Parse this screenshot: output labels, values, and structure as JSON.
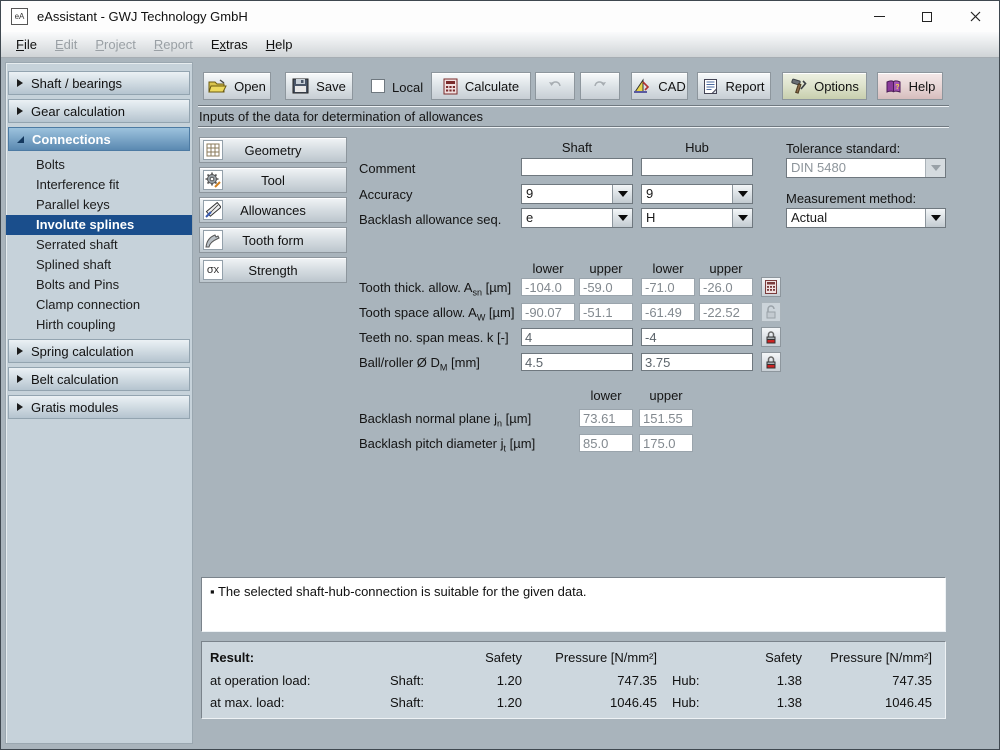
{
  "window": {
    "title": "eAssistant - GWJ Technology GmbH",
    "icon_text": "eA"
  },
  "menu": {
    "items": [
      {
        "pre": "",
        "key": "F",
        "post": "ile",
        "enabled": true
      },
      {
        "pre": "",
        "key": "E",
        "post": "dit",
        "enabled": false
      },
      {
        "pre": "",
        "key": "P",
        "post": "roject",
        "enabled": false
      },
      {
        "pre": "",
        "key": "R",
        "post": "eport",
        "enabled": false
      },
      {
        "pre": "E",
        "key": "x",
        "post": "tras",
        "enabled": true
      },
      {
        "pre": "",
        "key": "H",
        "post": "elp",
        "enabled": true
      }
    ]
  },
  "sidebar": {
    "sections": [
      {
        "label": "Shaft / bearings",
        "state": "collapsed"
      },
      {
        "label": "Gear calculation",
        "state": "collapsed"
      },
      {
        "label": "Connections",
        "state": "expanded",
        "items": [
          "Bolts",
          "Interference fit",
          "Parallel keys",
          "Involute splines",
          "Serrated shaft",
          "Splined shaft",
          "Bolts and Pins",
          "Clamp connection",
          "Hirth coupling"
        ],
        "selected": "Involute splines"
      },
      {
        "label": "Spring calculation",
        "state": "collapsed"
      },
      {
        "label": "Belt calculation",
        "state": "collapsed"
      },
      {
        "label": "Gratis modules",
        "state": "collapsed"
      }
    ]
  },
  "toolbar": {
    "open": "Open",
    "save": "Save",
    "local": "Local",
    "local_checked": false,
    "calculate": "Calculate",
    "cad": "CAD",
    "report": "Report",
    "options": "Options",
    "help": "Help"
  },
  "page": {
    "header": "Inputs of the data for determination of allowances"
  },
  "nav_buttons": {
    "geometry": "Geometry",
    "tool": "Tool",
    "allowances": "Allowances",
    "tooth_form": "Tooth form",
    "strength": "Strength",
    "strength_icon_text": "σx"
  },
  "form": {
    "col_shaft": "Shaft",
    "col_hub": "Hub",
    "comment_label": "Comment",
    "comment_shaft": "",
    "comment_hub": "",
    "accuracy_label": "Accuracy",
    "accuracy_shaft": "9",
    "accuracy_hub": "9",
    "backlash_seq_label": "Backlash allowance seq.",
    "backlash_seq_shaft": "e",
    "backlash_seq_hub": "H",
    "tolerance_standard_label": "Tolerance standard:",
    "tolerance_standard_value": "DIN 5480",
    "measurement_method_label": "Measurement method:",
    "measurement_method_value": "Actual"
  },
  "allowances": {
    "headers": [
      "lower",
      "upper",
      "lower",
      "upper"
    ],
    "rows": [
      {
        "label_pre": "Tooth thick. allow. A",
        "label_sub": "sn",
        "label_post": " [µm]",
        "lower_shaft": "-104.0",
        "upper_shaft": "-59.0",
        "lower_hub": "-71.0",
        "upper_hub": "-26.0"
      },
      {
        "label_pre": "Tooth space allow. A",
        "label_sub": "W",
        "label_post": " [µm]",
        "lower_shaft": "-90.07",
        "upper_shaft": "-51.1",
        "lower_hub": "-61.49",
        "upper_hub": "-22.52"
      },
      {
        "label_pre": "Teeth no. span meas. k [-]",
        "label_sub": "",
        "label_post": "",
        "shaft": "4",
        "hub": "-4"
      },
      {
        "label_pre": "Ball/roller Ø D",
        "label_sub": "M",
        "label_post": " [mm]",
        "shaft": "4.5",
        "hub": "3.75"
      }
    ]
  },
  "backlash": {
    "headers": [
      "lower",
      "upper"
    ],
    "rows": [
      {
        "label_pre": "Backlash normal plane j",
        "label_sub": "n",
        "label_post": " [µm]",
        "lower": "73.61",
        "upper": "151.55"
      },
      {
        "label_pre": "Backlash pitch diameter j",
        "label_sub": "t",
        "label_post": " [µm]",
        "lower": "85.0",
        "upper": "175.0"
      }
    ]
  },
  "message": {
    "bullet": "▪",
    "text": " The selected shaft-hub-connection is suitable for the given data."
  },
  "result": {
    "title": "Result:",
    "safety_header": "Safety",
    "pressure_header": "Pressure [N/mm²]",
    "rows": [
      {
        "label": "at operation load:",
        "part1": "Shaft:",
        "safety1": "1.20",
        "pressure1": "747.35",
        "part2": "Hub:",
        "safety2": "1.38",
        "pressure2": "747.35"
      },
      {
        "label": "at max. load:",
        "part1": "Shaft:",
        "safety1": "1.20",
        "pressure1": "1046.45",
        "part2": "Hub:",
        "safety2": "1.38",
        "pressure2": "1046.45"
      }
    ]
  },
  "colors": {
    "selected_item_blue": "#1a4e8c",
    "expanded_header_top": "#9cc2dd",
    "expanded_header_bottom": "#5a89b1",
    "lock_red": "#cc2222",
    "content_background": "#a9b4bc",
    "sidebar_background": "#c6d2da",
    "result_panel_background": "#cdd7de"
  }
}
